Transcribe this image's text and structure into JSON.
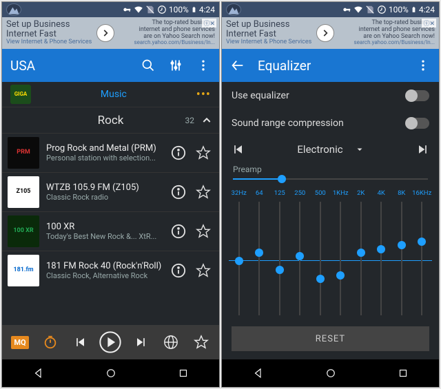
{
  "status": {
    "time": "4:24",
    "battery": "100%"
  },
  "ad": {
    "headline1": "Set up Business",
    "headline2": "Internet Fast",
    "sub1": "View Internet & Phone Services",
    "right1": "The top-rated business",
    "right2": "internet and phone services",
    "right3": "are on Yahoo Search now!",
    "rightsub": "search.yahoo.com/Business/In..."
  },
  "left": {
    "title": "USA",
    "tab": "Music",
    "category": "Rock",
    "category_count": "32",
    "stations": [
      {
        "title": "Prog Rock and Metal (PRM)",
        "sub": "Personal station with selection...",
        "art_bg": "#0a0a0a",
        "art_label": "PRM"
      },
      {
        "title": "WTZB  105.9 FM (Z105)",
        "sub": "Classic Rock radio",
        "art_bg": "#ffffff",
        "art_label": "Z105"
      },
      {
        "title": "100 XR",
        "sub": "Today's Best New Rock &... XtR...",
        "art_bg": "#0a2a0a",
        "art_label": "100 XR"
      },
      {
        "title": "181 FM Rock 40 (Rock'n'Roll)",
        "sub": "Classic Rock, Alternative Rock",
        "art_bg": "#ffffff",
        "art_label": "181.fm"
      }
    ]
  },
  "right": {
    "title": "Equalizer",
    "rows": {
      "use": "Use equalizer",
      "compress": "Sound range compression"
    },
    "preset": "Electronic",
    "preamp_label": "Preamp",
    "preamp_pct": 25,
    "reset": "RESET",
    "bands": [
      {
        "hz": "32Hz",
        "pct": 52
      },
      {
        "hz": "64",
        "pct": 45
      },
      {
        "hz": "125",
        "pct": 60
      },
      {
        "hz": "250",
        "pct": 48
      },
      {
        "hz": "500",
        "pct": 68
      },
      {
        "hz": "1KHz",
        "pct": 65
      },
      {
        "hz": "2K",
        "pct": 45
      },
      {
        "hz": "4K",
        "pct": 42
      },
      {
        "hz": "8K",
        "pct": 38
      },
      {
        "hz": "16KHz",
        "pct": 35
      }
    ]
  }
}
